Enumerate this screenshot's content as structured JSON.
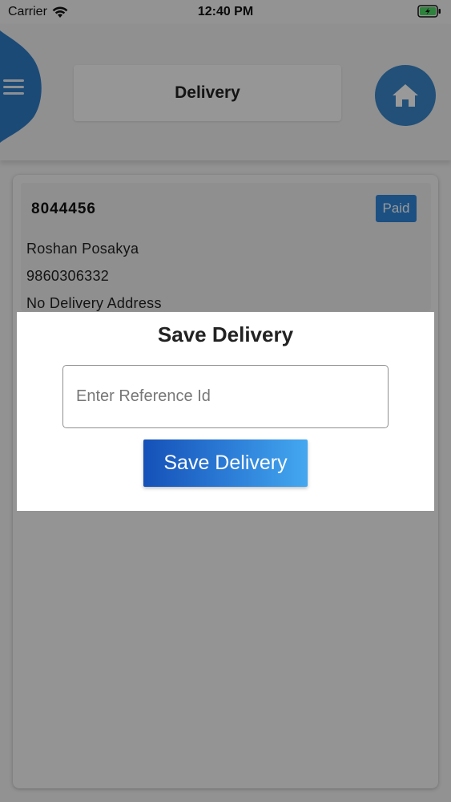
{
  "status_bar": {
    "carrier": "Carrier",
    "time": "12:40 PM"
  },
  "header": {
    "title": "Delivery",
    "menu_icon": "hamburger-icon",
    "home_icon": "home-icon"
  },
  "order": {
    "id": "8044456",
    "payment_status": "Paid",
    "customer_name": "Roshan Posakya",
    "phone": "9860306332",
    "address": "No Delivery Address"
  },
  "dialog": {
    "title": "Save Delivery",
    "reference_input": {
      "value": "",
      "placeholder": "Enter Reference Id"
    },
    "save_button_label": "Save Delivery"
  },
  "colors": {
    "accent_blue": "#2f86d9",
    "home_button": "#3a86c8",
    "save_gradient_start": "#1550b8",
    "save_gradient_end": "#44a8f0"
  }
}
